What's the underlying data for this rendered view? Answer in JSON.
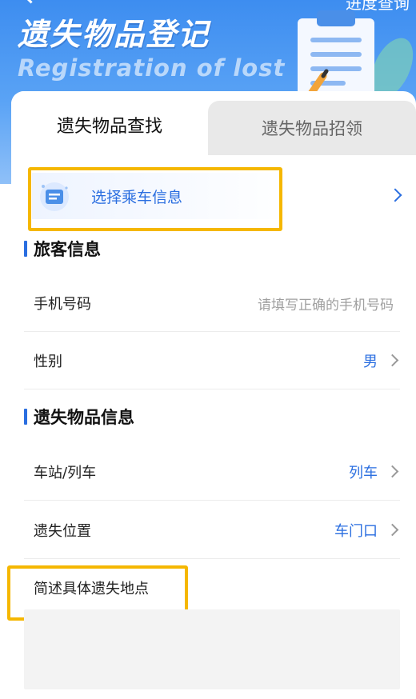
{
  "header": {
    "title": "遗失物品登记",
    "subtitle": "Registration of lost",
    "top_link": "进度查询"
  },
  "tabs": [
    {
      "label": "遗失物品查找",
      "active": true
    },
    {
      "label": "遗失物品招领",
      "active": false
    }
  ],
  "ride_info": {
    "label": "选择乘车信息"
  },
  "passenger_section": {
    "title": "旅客信息",
    "phone": {
      "label": "手机号码",
      "placeholder": "请填写正确的手机号码"
    },
    "gender": {
      "label": "性别",
      "value": "男"
    }
  },
  "item_section": {
    "title": "遗失物品信息",
    "station": {
      "label": "车站/列车",
      "value": "列车"
    },
    "location": {
      "label": "遗失位置",
      "value": "车门口"
    },
    "description": {
      "label": "简述具体遗失地点",
      "value": ""
    }
  },
  "colors": {
    "accent": "#2a6ee0",
    "highlight": "#f5b700",
    "header_blue": "#3d8df0"
  }
}
